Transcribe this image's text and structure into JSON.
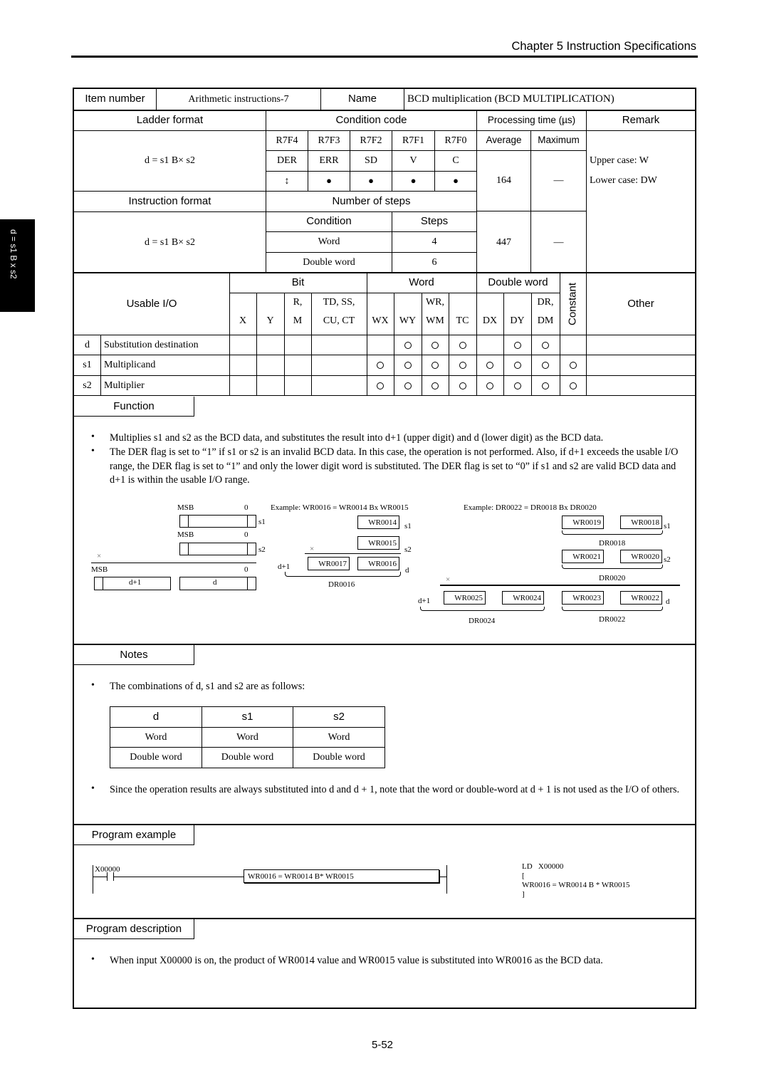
{
  "header": {
    "chapter_title": "Chapter 5  Instruction Specifications"
  },
  "side_tab": {
    "label": "d = s1 B x s2"
  },
  "spec": {
    "item_number_label": "Item number",
    "item_number_value": "Arithmetic instructions-7",
    "name_label": "Name",
    "name_value": "BCD multiplication (BCD MULTIPLICATION)",
    "ladder_format_label": "Ladder format",
    "ladder_format_value": "d = s1 B× s2",
    "condition_code_label": "Condition code",
    "processing_time_label": "Processing time (µs)",
    "remark_label": "Remark",
    "registers": [
      "R7F4",
      "R7F3",
      "R7F2",
      "R7F1",
      "R7F0"
    ],
    "flags": [
      "DER",
      "ERR",
      "SD",
      "V",
      "C"
    ],
    "flag_states": [
      "↕",
      "●",
      "●",
      "●",
      "●"
    ],
    "average_label": "Average",
    "maximum_label": "Maximum",
    "avg_word": "164",
    "max_word": "—",
    "avg_dword": "447",
    "max_dword": "—",
    "remark_upper": "Upper case: W",
    "remark_lower": "Lower case: DW",
    "instruction_format_label": "Instruction format",
    "instruction_format_value": "d = s1 B× s2",
    "number_of_steps_label": "Number of steps",
    "condition_label": "Condition",
    "steps_label": "Steps",
    "steps": [
      {
        "condition": "Word",
        "steps": "4"
      },
      {
        "condition": "Double word",
        "steps": "6"
      }
    ]
  },
  "usable_io": {
    "label": "Usable I/O",
    "group_bit": "Bit",
    "group_word": "Word",
    "group_dword": "Double word",
    "constant": "Constant",
    "other": "Other",
    "columns_top": [
      "",
      "",
      "R,",
      "TD, SS,",
      "",
      "",
      "WR,",
      "",
      "",
      "",
      "DR,"
    ],
    "columns_bottom": [
      "X",
      "Y",
      "M",
      "CU, CT",
      "WX",
      "WY",
      "WM",
      "TC",
      "DX",
      "DY",
      "DM"
    ],
    "rows": [
      {
        "symbol": "d",
        "name": "Substitution destination",
        "marks": [
          0,
          0,
          0,
          0,
          0,
          1,
          1,
          1,
          0,
          1,
          1,
          0
        ]
      },
      {
        "symbol": "s1",
        "name": "Multiplicand",
        "marks": [
          0,
          0,
          0,
          0,
          1,
          1,
          1,
          1,
          1,
          1,
          1,
          1
        ]
      },
      {
        "symbol": "s2",
        "name": "Multiplier",
        "marks": [
          0,
          0,
          0,
          0,
          1,
          1,
          1,
          1,
          1,
          1,
          1,
          1
        ]
      }
    ]
  },
  "function": {
    "label": "Function",
    "bullets": [
      "Multiplies s1 and s2 as the BCD data, and substitutes the result into d+1 (upper digit) and d (lower digit) as the BCD data.",
      "The DER flag is set to “1” if s1 or s2 is an invalid BCD data.  In this case, the operation is not performed.  Also, if d+1 exceeds the usable I/O range, the DER flag is set to “1” and only the lower digit word is substituted.  The DER flag is set to “0” if s1 and s2 are valid BCD data and d+1 is within the usable I/O range."
    ],
    "diagram": {
      "msb": "MSB",
      "zero": "0",
      "s1": "s1",
      "s2": "s2",
      "times": "×",
      "d1": "d+1",
      "d": "d",
      "example1_title": "Example: WR0016 = WR0014 Bx  WR0015",
      "ex1": {
        "s1": "WR0014",
        "s2": "WR0015",
        "d_hi": "WR0017",
        "d_lo": "WR0016",
        "dr": "DR0016"
      },
      "example2_title": "Example: DR0022 = DR0018 Bx DR0020",
      "ex2": {
        "s1_hi": "WR0019",
        "s1_lo": "WR0018",
        "s1_dr": "DR0018",
        "s2_hi": "WR0021",
        "s2_lo": "WR0020",
        "s2_dr": "DR0020",
        "r1": "WR0025",
        "r2": "WR0024",
        "r3": "WR0023",
        "r4": "WR0022",
        "dr_hi": "DR0024",
        "dr_lo": "DR0022"
      }
    }
  },
  "notes": {
    "label": "Notes",
    "bullet1": "The combinations of d, s1 and s2 are as follows:",
    "table_headers": [
      "d",
      "s1",
      "s2"
    ],
    "table_rows": [
      [
        "Word",
        "Word",
        "Word"
      ],
      [
        "Double word",
        "Double word",
        "Double word"
      ]
    ],
    "bullet2": "Since the operation results are always substituted into d and d + 1, note that the word or double-word at d + 1 is not used as the I/O of others."
  },
  "program_example": {
    "label": "Program example",
    "contact": "X00000",
    "box_text": "WR0016 = WR0014 B* WR0015",
    "mnemonic": [
      "LD   X00000",
      "[",
      "WR0016 = WR0014 B * WR0015",
      "]"
    ]
  },
  "program_description": {
    "label": "Program description",
    "bullet": "When input X00000 is on, the product of WR0014 value and WR0015 value is substituted into WR0016 as the BCD data."
  },
  "footer": {
    "page_number": "5-52"
  }
}
